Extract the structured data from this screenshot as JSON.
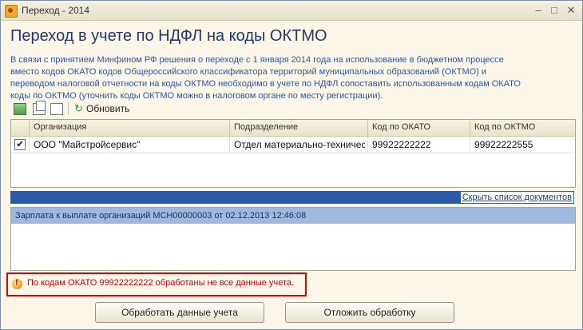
{
  "window": {
    "title": "Переход - 2014"
  },
  "heading": "Переход в учете по НДФЛ на коды ОКТМО",
  "info_lines": [
    "В связи с принятием Минфином РФ решения о переходе с 1 января 2014 года на использование в бюджетном процессе",
    "вместо кодов ОКАТО кодов Общероссийского классификатора территорий муниципальных образований (ОКТМО) и",
    "переводом налоговой отчетности на коды ОКТМО необходимо в учете по НДФЛ сопоставить использованным кодам ОКАТО",
    "коды по ОКТМО (уточнить коды ОКТМО можно в налоговом органе по месту регистрации)."
  ],
  "toolbar": {
    "refresh_label": "Обновить",
    "icons": [
      "select-all-icon",
      "copy-icon",
      "toggle-check-icon",
      "refresh-icon"
    ]
  },
  "table": {
    "columns": [
      "Организация",
      "Подразделение",
      "Код по ОКАТО",
      "Код по ОКТМО"
    ],
    "rows": [
      {
        "checked": true,
        "org": "ООО \"Майстройсервис\"",
        "dept": "Отдел материально-техническ...",
        "okato": "99922222222",
        "oktmo": "99922222555"
      }
    ]
  },
  "docs": {
    "hide_link": "Скрыть список документов",
    "items": [
      "Зарплата к выплате организаций МСН00000003 от 02.12.2013 12:46:08"
    ]
  },
  "warning": "По кодам ОКАТО 99922222222 обработаны не все данные учета.",
  "buttons": {
    "process": "Обработать данные учета",
    "postpone": "Отложить обработку"
  },
  "colors": {
    "accent": "#2c5aa6",
    "warning": "#e00000",
    "heading": "#1f3a6b"
  }
}
